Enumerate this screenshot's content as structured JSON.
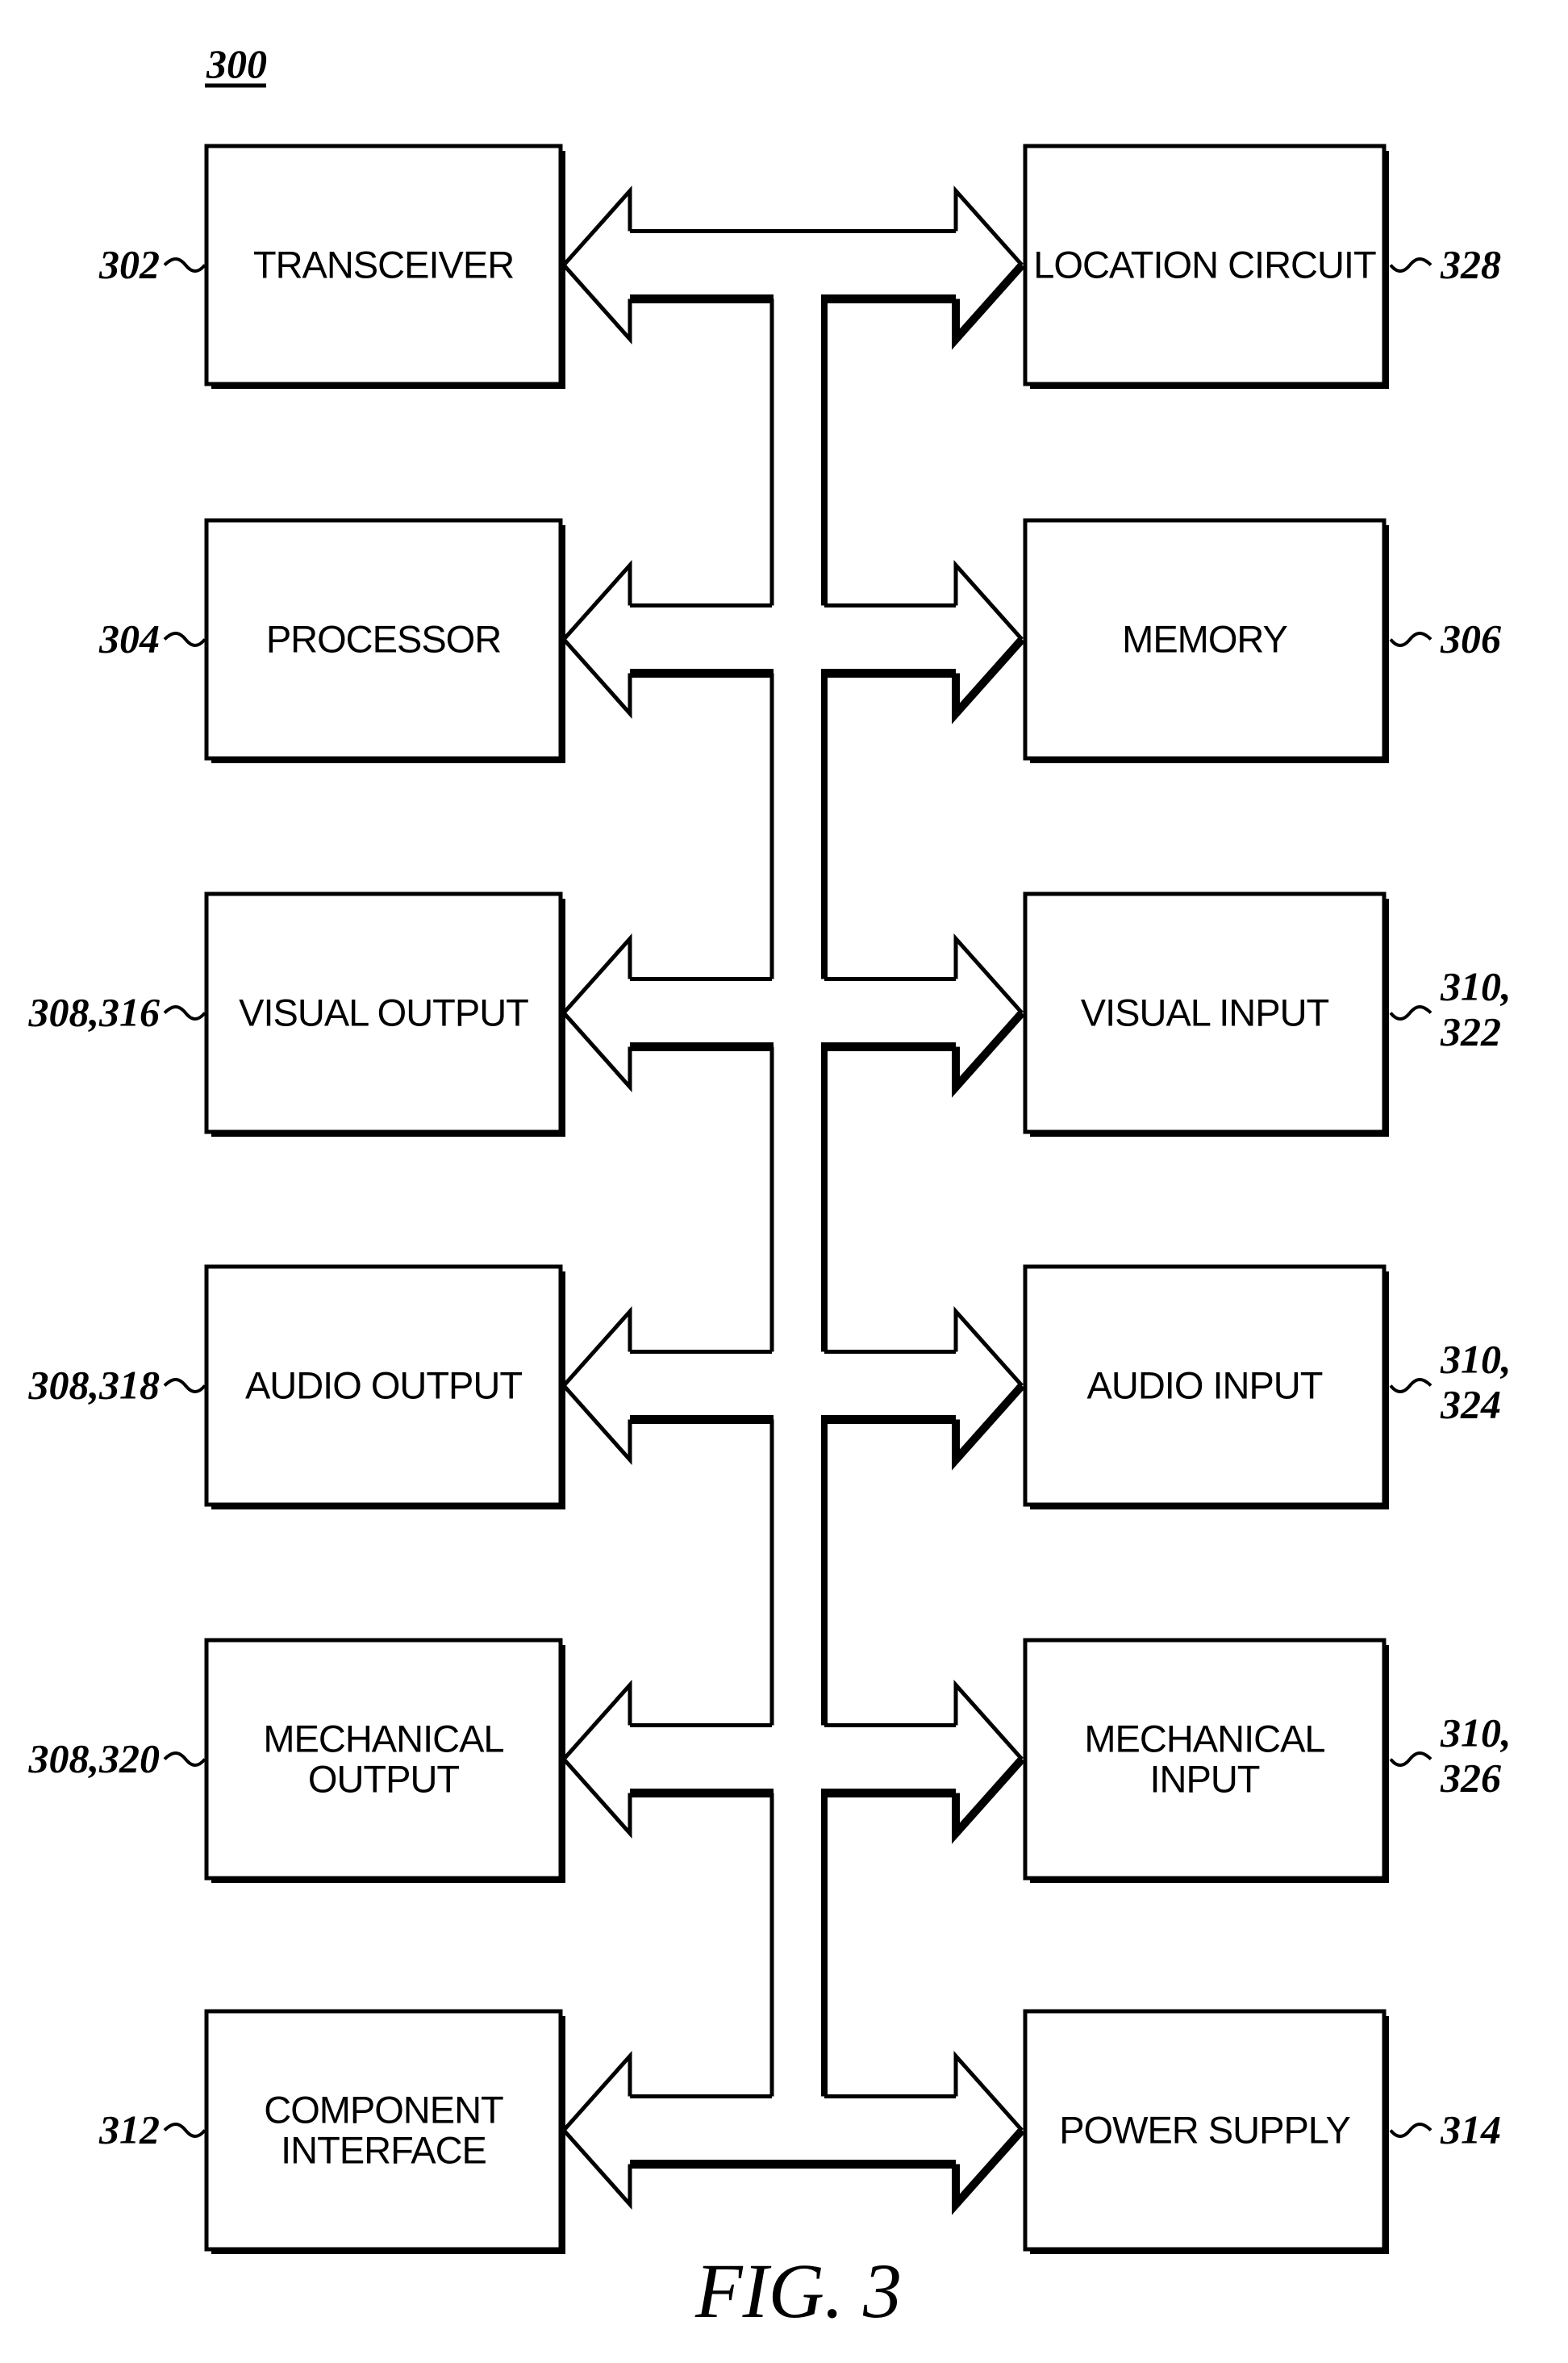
{
  "figure": {
    "number_label": "300",
    "caption": "FIG. 3"
  },
  "blocks": [
    {
      "id": "transceiver",
      "side": "left",
      "row": 0,
      "lines": [
        "TRANSCEIVER"
      ],
      "ref": [
        "302"
      ]
    },
    {
      "id": "location-circuit",
      "side": "right",
      "row": 0,
      "lines": [
        "LOCATION CIRCUIT"
      ],
      "ref": [
        "328"
      ]
    },
    {
      "id": "processor",
      "side": "left",
      "row": 1,
      "lines": [
        "PROCESSOR"
      ],
      "ref": [
        "304"
      ]
    },
    {
      "id": "memory",
      "side": "right",
      "row": 1,
      "lines": [
        "MEMORY"
      ],
      "ref": [
        "306"
      ]
    },
    {
      "id": "visual-output",
      "side": "left",
      "row": 2,
      "lines": [
        "VISUAL OUTPUT"
      ],
      "ref": [
        "308,316"
      ]
    },
    {
      "id": "visual-input",
      "side": "right",
      "row": 2,
      "lines": [
        "VISUAL INPUT"
      ],
      "ref": [
        "310,",
        "322"
      ]
    },
    {
      "id": "audio-output",
      "side": "left",
      "row": 3,
      "lines": [
        "AUDIO OUTPUT"
      ],
      "ref": [
        "308,318"
      ]
    },
    {
      "id": "audio-input",
      "side": "right",
      "row": 3,
      "lines": [
        "AUDIO INPUT"
      ],
      "ref": [
        "310,",
        "324"
      ]
    },
    {
      "id": "mechanical-output",
      "side": "left",
      "row": 4,
      "lines": [
        "MECHANICAL",
        "OUTPUT"
      ],
      "ref": [
        "308,320"
      ]
    },
    {
      "id": "mechanical-input",
      "side": "right",
      "row": 4,
      "lines": [
        "MECHANICAL",
        "INPUT"
      ],
      "ref": [
        "310,",
        "326"
      ]
    },
    {
      "id": "component-interface",
      "side": "left",
      "row": 5,
      "lines": [
        "COMPONENT",
        "INTERFACE"
      ],
      "ref": [
        "312"
      ]
    },
    {
      "id": "power-supply",
      "side": "right",
      "row": 5,
      "lines": [
        "POWER SUPPLY"
      ],
      "ref": [
        "314"
      ]
    }
  ],
  "bus": {
    "name": "shared-bus",
    "connects_rows": 6
  },
  "colors": {
    "ink": "#000000",
    "paper": "#ffffff"
  }
}
